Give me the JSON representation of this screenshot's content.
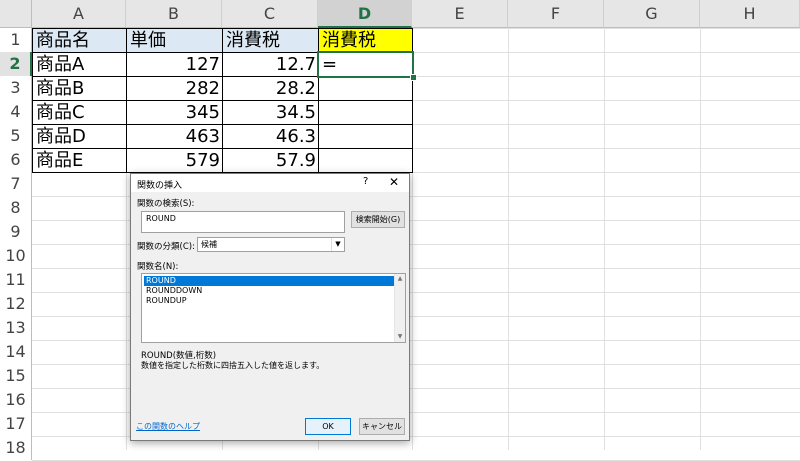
{
  "columns": [
    "A",
    "B",
    "C",
    "D",
    "E",
    "F",
    "G",
    "H"
  ],
  "active_column": "D",
  "rows": [
    "1",
    "2",
    "3",
    "4",
    "5",
    "6",
    "7",
    "8",
    "9",
    "10",
    "11",
    "12",
    "13",
    "14",
    "15",
    "16",
    "17",
    "18"
  ],
  "active_row": "2",
  "table": {
    "header": [
      "商品名",
      "単価",
      "消費税",
      "消費税"
    ],
    "data": [
      {
        "name": "商品A",
        "price": "127",
        "tax": "12.7",
        "d": "="
      },
      {
        "name": "商品B",
        "price": "282",
        "tax": "28.2",
        "d": ""
      },
      {
        "name": "商品C",
        "price": "345",
        "tax": "34.5",
        "d": ""
      },
      {
        "name": "商品D",
        "price": "463",
        "tax": "46.3",
        "d": ""
      },
      {
        "name": "商品E",
        "price": "579",
        "tax": "57.9",
        "d": ""
      }
    ]
  },
  "colors": {
    "header_blue": "#dce9f5",
    "header_yellow": "#ffff00",
    "accent_green": "#217346",
    "selection_blue": "#0078d7"
  },
  "dialog": {
    "title": "関数の挿入",
    "help_glyph": "?",
    "close_glyph": "✕",
    "search_label": "関数の検索(S):",
    "search_value": "ROUND",
    "search_button": "検索開始(G)",
    "category_label": "関数の分類(C):",
    "category_value": "候補",
    "function_list_label": "関数名(N):",
    "functions": [
      "ROUND",
      "ROUNDDOWN",
      "ROUNDUP"
    ],
    "selected_function": "ROUND",
    "syntax": "ROUND(数値,桁数)",
    "description": "数値を指定した桁数に四捨五入した値を返します。",
    "help_link": "この関数のヘルプ",
    "ok_label": "OK",
    "cancel_label": "キャンセル"
  }
}
